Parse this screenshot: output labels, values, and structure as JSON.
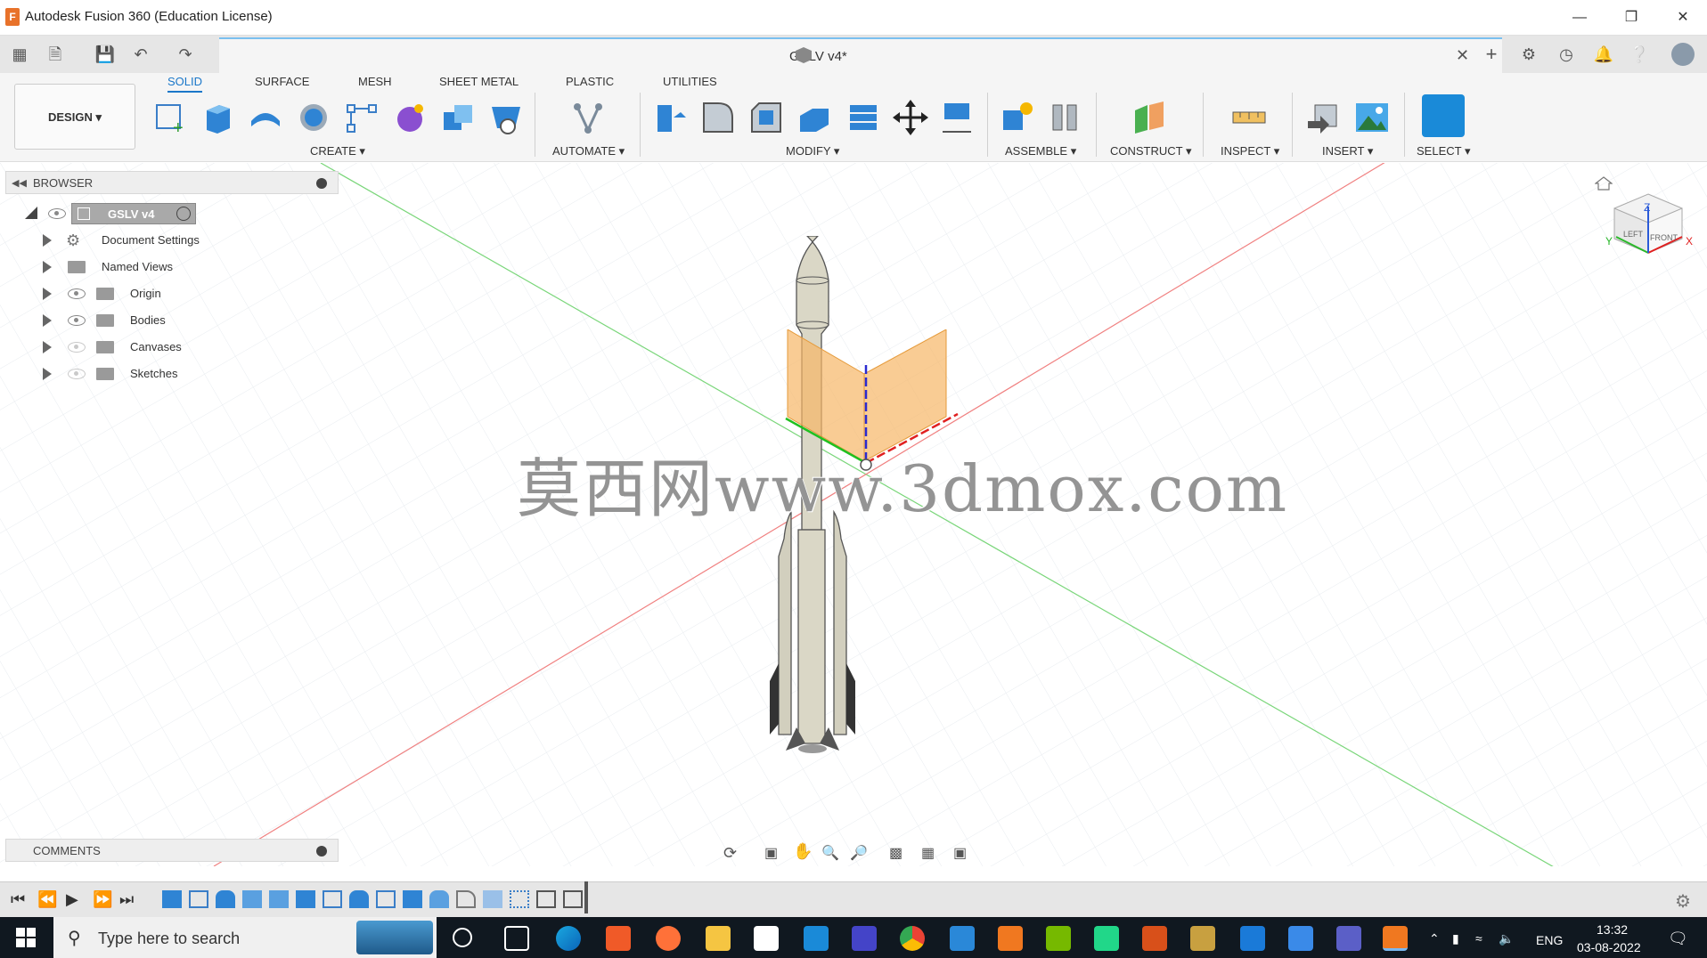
{
  "window": {
    "title": "Autodesk Fusion 360 (Education License)",
    "minimize": "—",
    "restore": "❐",
    "close": "✕"
  },
  "document": {
    "tab_title": "GSLV v4*"
  },
  "ribbon": {
    "tabs": [
      "SOLID",
      "SURFACE",
      "MESH",
      "SHEET METAL",
      "PLASTIC",
      "UTILITIES"
    ],
    "workspace": "DESIGN ▾",
    "groups": [
      "CREATE ▾",
      "AUTOMATE ▾",
      "MODIFY ▾",
      "ASSEMBLE ▾",
      "CONSTRUCT ▾",
      "INSPECT ▾",
      "INSERT ▾",
      "SELECT ▾"
    ]
  },
  "browser": {
    "title": "BROWSER",
    "root": "GSLV v4",
    "items": [
      "Document Settings",
      "Named Views",
      "Origin",
      "Bodies",
      "Canvases",
      "Sketches"
    ]
  },
  "comments": {
    "title": "COMMENTS"
  },
  "viewcube": {
    "left": "LEFT",
    "front": "FRONT",
    "axis_x": "X",
    "axis_y": "Y",
    "axis_z": "Z"
  },
  "watermark": "莫西网www.3dmox.com",
  "taskbar": {
    "search_placeholder": "Type here to search",
    "lang": "ENG",
    "time": "13:32",
    "date": "03-08-2022"
  },
  "colors": {
    "accent": "#1a77c9",
    "plane": "#f6b766",
    "taskbar": "#101820"
  }
}
